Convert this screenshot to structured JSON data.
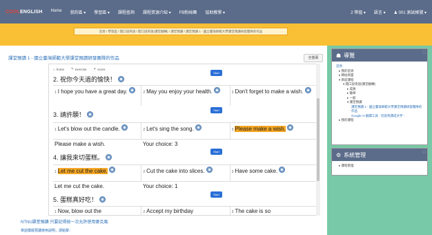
{
  "topnav": {
    "logo_a": "COOL",
    "logo_b": "ENGLISH",
    "items": [
      "Home",
      "我的區 ▾",
      "學習區 ▾",
      "課程查詢",
      "課程資源介紹 ▾",
      "FB粉絲團",
      "協助教學 ▾"
    ],
    "right_items": [
      "2 幣值 ▾",
      "語言 ▾",
      "♟ 001 測試帳號 ▾"
    ]
  },
  "breadcrumb": "首頁 / 學習區 / 開口說英語 / 開口說英語(課堂翻轉) / 課堂預讀 / 課堂預讀 1 - 國立臺灣師範大學課堂預讀研發團隊的作品",
  "page": {
    "title": "課堂預讀 1 - 國立臺灣師範大學課堂預讀研發團隊的作品",
    "fullscreen_label": "全螢幕"
  },
  "tabs": [
    "home",
    "exercise",
    "score"
  ],
  "sections": [
    {
      "title": "2. 祝你今天過的愉快！",
      "start_label": "Start",
      "options": [
        "I hope you have a great day.",
        "May you enjoy your health.",
        "Don't forget to make a wish."
      ],
      "highlight": -1
    },
    {
      "title": "3. 請許願！",
      "start_label": "Start",
      "options": [
        "Let's blow out the candle.",
        "Let's sing the song.",
        "Please make a wish."
      ],
      "highlight": 2,
      "result": "Please make a wish.",
      "choice": "Your choice: 3"
    },
    {
      "title": "4. 讓我來切蛋糕。",
      "start_label": "Start",
      "options": [
        "Let me cut the cake.",
        "Cut the cake into slices.",
        "Have some cake."
      ],
      "highlight": 0,
      "result": "Let me cut the cake.",
      "choice": "Your choice: 1"
    },
    {
      "title": "5. 蛋糕真好吃！",
      "start_label": "Start",
      "options": [
        "Now, blow out the",
        "Accept my birthday",
        "The cake is so"
      ],
      "highlight": -1
    }
  ],
  "footer": {
    "link1": "NTNU課堂預讀 只要記得按一次允許使用麥克風",
    "link2": "單語模版預讀使用說明，請點擊："
  },
  "sidebar": {
    "nav_title": "導覽",
    "nav_items": [
      {
        "label": "首頁",
        "level": 0
      },
      {
        "label": "▸ 我的首頁",
        "level": 1
      },
      {
        "label": "▸ 網站頁面",
        "level": 1
      },
      {
        "label": "▾ 目前課程",
        "level": 1
      },
      {
        "label": "▾ 開口說英語(課堂翻轉)",
        "level": 2
      },
      {
        "label": "▸ 成員",
        "level": 3
      },
      {
        "label": "▸ 徽章",
        "level": 3
      },
      {
        "label": "▸ 一般",
        "level": 3
      },
      {
        "label": "▾ 課堂預讀",
        "level": 3
      },
      {
        "label": "課堂預讀 1 - 國立臺灣師範大學課堂預讀研發團隊的作品",
        "level": 4
      },
      {
        "label": "Google AI 翻譯工具 - 近說英譯成文字 -",
        "level": 4
      },
      {
        "label": "▸ 我的課程",
        "level": 1
      }
    ],
    "admin_title": "系統管理",
    "admin_items": [
      "▸ 課程管理"
    ]
  }
}
